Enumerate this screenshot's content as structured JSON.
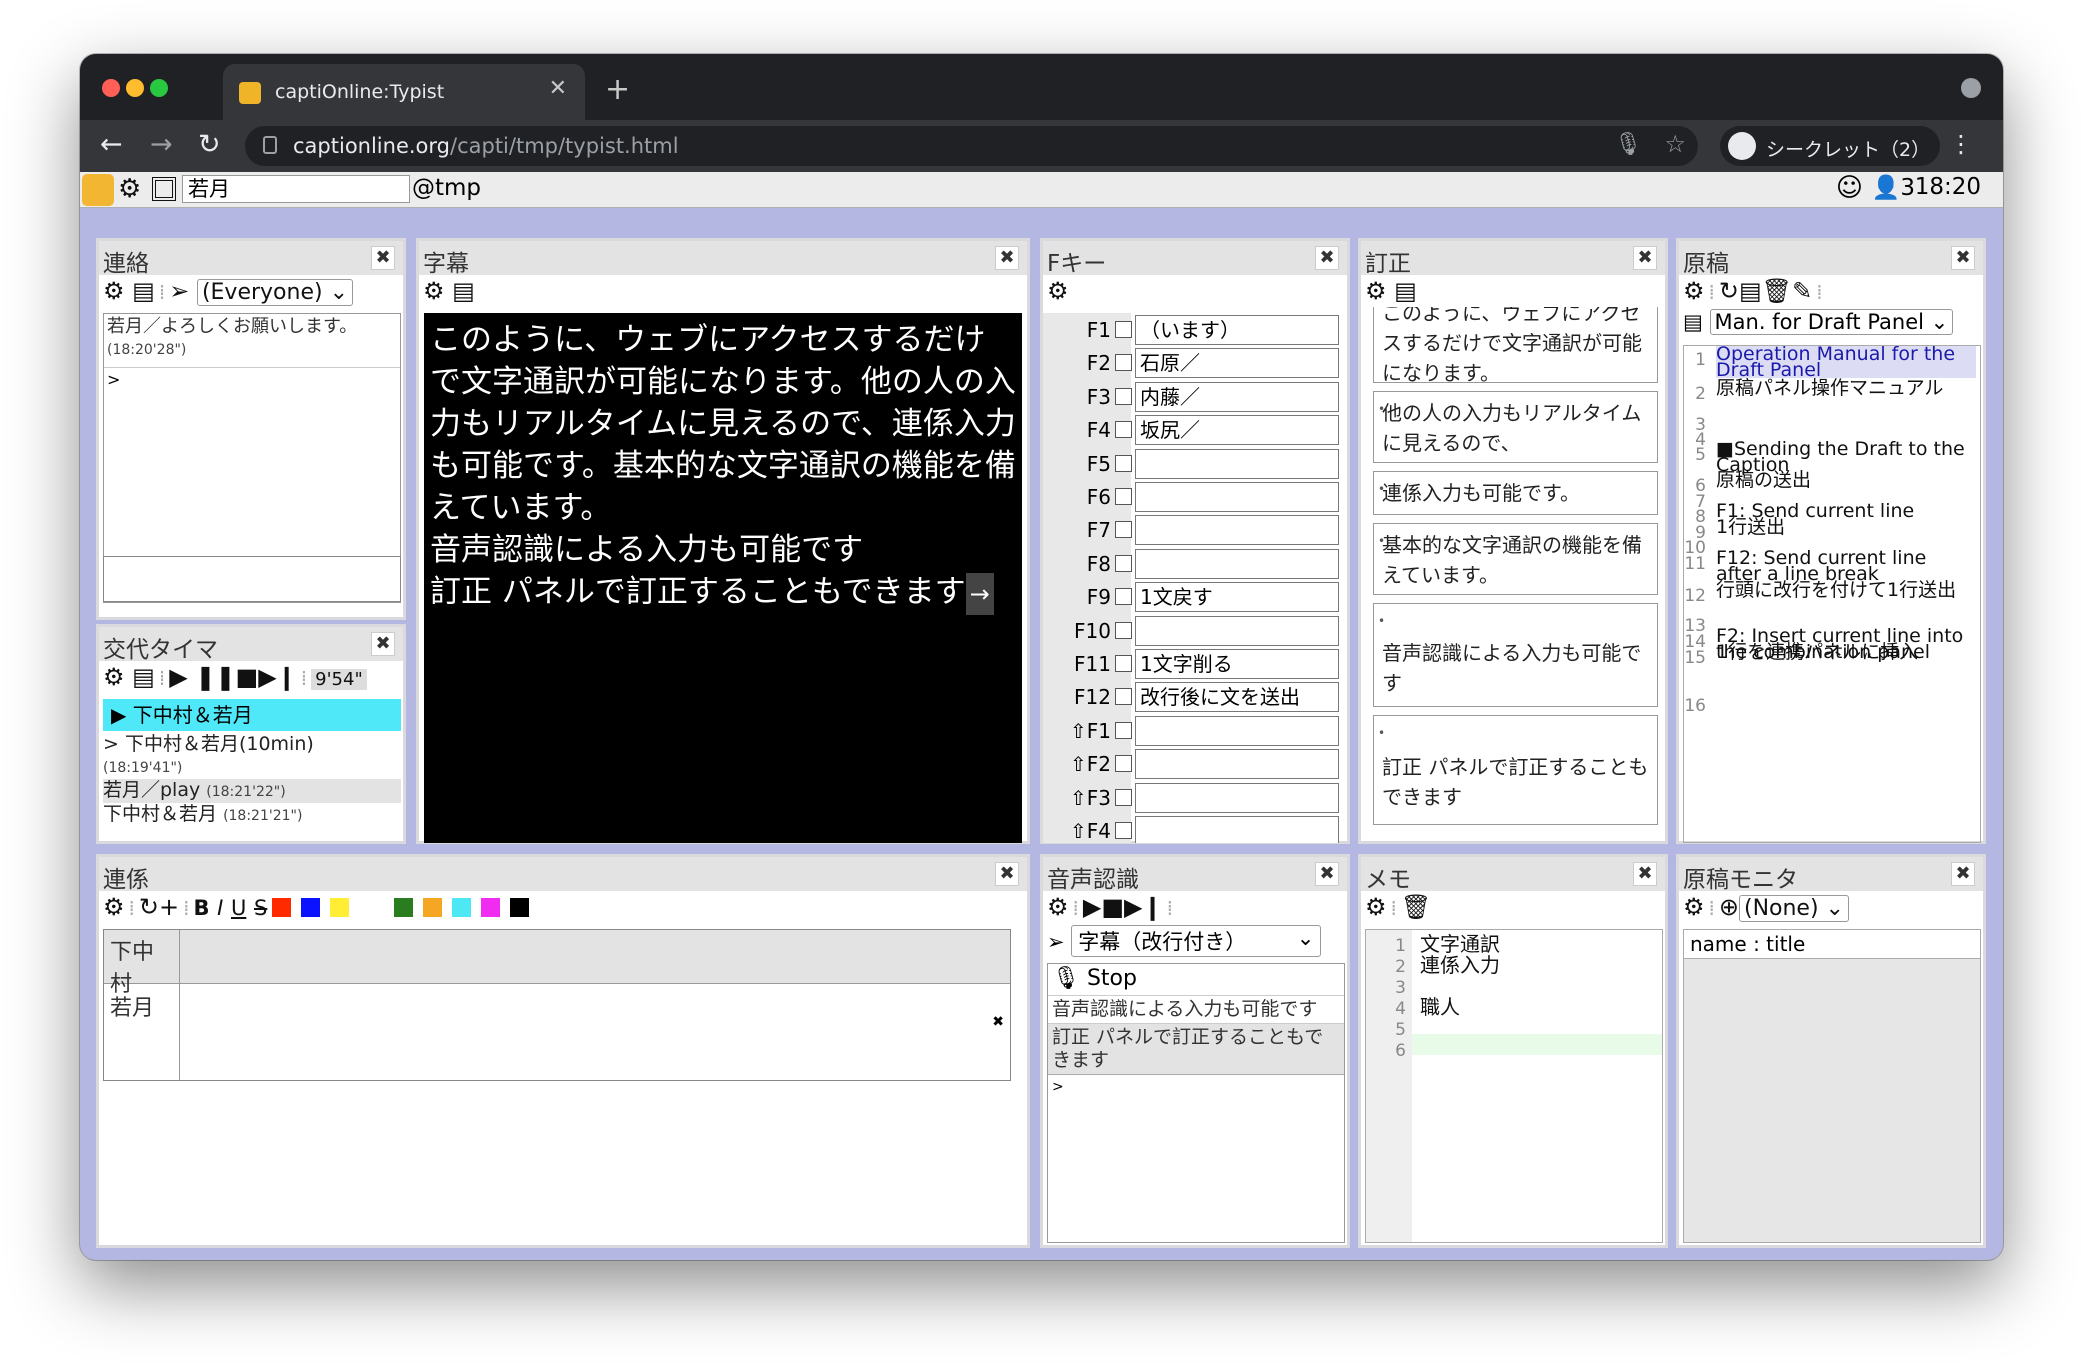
{
  "browser": {
    "tab_title": "captiOnline:Typist",
    "url_host": "captionline.org",
    "url_path": "/capti/tmp/typist.html",
    "profile_label": "シークレット（2）"
  },
  "appbar": {
    "username": "若月",
    "room": "@tmp",
    "user_count": "3",
    "time": "18:20"
  },
  "renraku": {
    "title": "連絡",
    "target": "(Everyone)",
    "log_text": "若月／よろしくお願いします。",
    "log_time": "(18:20'28\")",
    "prompt": ">"
  },
  "timer": {
    "title": "交代タイマ",
    "remaining": "9'54\"",
    "current": "▶ 下中村＆若月",
    "logs": [
      {
        "text": "> 下中村＆若月(10min)",
        "time": "(18:19'41\")"
      },
      {
        "text": "若月／play",
        "time": "(18:21'22\")"
      },
      {
        "text": "下中村＆若月",
        "time": "(18:21'21\")"
      }
    ]
  },
  "caption": {
    "title": "字幕",
    "lines": [
      "このように、ウェブにアクセスするだけで文字通訳が可能になります。他の人の入力もリアルタイムに見えるので、連係入力も可能です。基本的な文字通訳の機能を備えています。",
      "音声認識による入力も可能です",
      "訂正 パネルで訂正することもできます"
    ],
    "arrow": "→"
  },
  "fkeys": {
    "title": "Fキー",
    "rows": [
      {
        "key": "F1",
        "value": "（います）"
      },
      {
        "key": "F2",
        "value": "石原／"
      },
      {
        "key": "F3",
        "value": "内藤／"
      },
      {
        "key": "F4",
        "value": "坂尻／"
      },
      {
        "key": "F5",
        "value": ""
      },
      {
        "key": "F6",
        "value": ""
      },
      {
        "key": "F7",
        "value": ""
      },
      {
        "key": "F8",
        "value": ""
      },
      {
        "key": "F9",
        "value": "1文戻す"
      },
      {
        "key": "F10",
        "value": ""
      },
      {
        "key": "F11",
        "value": "1文字削る"
      },
      {
        "key": "F12",
        "value": "改行後に文を送出"
      },
      {
        "key": "⇧F1",
        "value": ""
      },
      {
        "key": "⇧F2",
        "value": ""
      },
      {
        "key": "⇧F3",
        "value": ""
      },
      {
        "key": "⇧F4",
        "value": ""
      }
    ]
  },
  "correction": {
    "title": "訂正",
    "items": [
      "このように、ウェブにアクセスするだけで文字通訳が可能になります。",
      "他の人の入力もリアルタイムに見えるので、",
      "連係入力も可能です。",
      "基本的な文字通訳の機能を備えています。",
      "音声認識による入力も可能です",
      "訂正 パネルで訂正することもできます"
    ]
  },
  "draft": {
    "title": "原稿",
    "selected": "Man. for Draft Panel",
    "lines": [
      {
        "n": "1",
        "text": "Operation Manual for the Draft Panel"
      },
      {
        "n": "2",
        "text": "原稿パネル操作マニュアル"
      },
      {
        "n": "3",
        "text": ""
      },
      {
        "n": "4",
        "text": ""
      },
      {
        "n": "5",
        "text": "■Sending the Draft to the Caption"
      },
      {
        "n": "6",
        "text": "原稿の送出"
      },
      {
        "n": "7",
        "text": ""
      },
      {
        "n": "8",
        "text": "F1: Send current line"
      },
      {
        "n": "9",
        "text": "1行送出"
      },
      {
        "n": "10",
        "text": ""
      },
      {
        "n": "11",
        "text": "F12: Send current line after a line break"
      },
      {
        "n": "12",
        "text": "行頭に改行を付けて1行送出"
      },
      {
        "n": "13",
        "text": ""
      },
      {
        "n": "14",
        "text": "F2: Insert current line into the combination panel"
      },
      {
        "n": "15",
        "text": "1行を連携パネルに挿入"
      },
      {
        "n": "16",
        "text": ""
      }
    ]
  },
  "renkei": {
    "title": "連係",
    "user1": "下中村",
    "user2": "若月",
    "colors": [
      "#ff2a00",
      "#0a12ff",
      "#ffee33",
      "#2a7d1e",
      "#f5a623",
      "#4ee8f5",
      "#f02cf0",
      "#000000"
    ]
  },
  "speech": {
    "title": "音声認識",
    "target": "字幕（改行付き）",
    "stop_label": "Stop",
    "results": [
      "音声認識による入力も可能です",
      "訂正 パネルで訂正することもできます"
    ],
    "prompt": ">"
  },
  "memo": {
    "title": "メモ",
    "lines": [
      {
        "n": "1",
        "text": "文字通訳"
      },
      {
        "n": "2",
        "text": "連係入力"
      },
      {
        "n": "3",
        "text": ""
      },
      {
        "n": "4",
        "text": "職人"
      },
      {
        "n": "5",
        "text": ""
      },
      {
        "n": "6",
        "text": ""
      }
    ]
  },
  "monitor": {
    "title": "原稿モニタ",
    "selected": "(None)",
    "header": "name : title"
  }
}
